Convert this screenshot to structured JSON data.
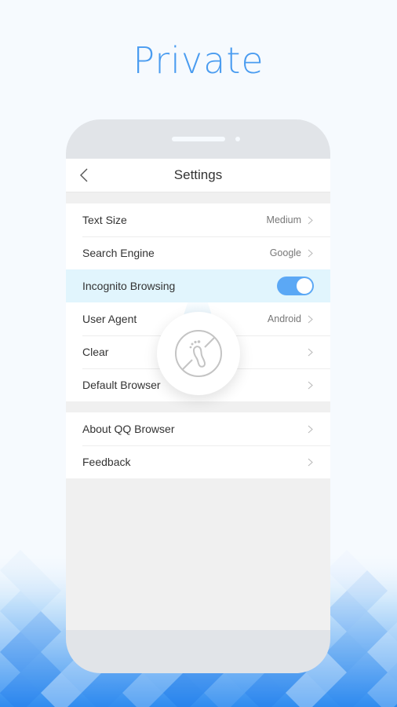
{
  "headline": "Private",
  "settings": {
    "title": "Settings",
    "back_icon": "chevron-left-icon",
    "group1": [
      {
        "label": "Text Size",
        "value": "Medium",
        "type": "chevron"
      },
      {
        "label": "Search Engine",
        "value": "Google",
        "type": "chevron"
      },
      {
        "label": "Incognito Browsing",
        "value": "",
        "type": "toggle",
        "on": true
      },
      {
        "label": "User Agent",
        "value": "Android",
        "type": "chevron"
      },
      {
        "label": "Clear",
        "value": "",
        "type": "chevron"
      },
      {
        "label": "Default Browser",
        "value": "",
        "type": "chevron"
      }
    ],
    "group2": [
      {
        "label": "About QQ Browser",
        "value": "",
        "type": "chevron"
      },
      {
        "label": "Feedback",
        "value": "",
        "type": "chevron"
      }
    ]
  },
  "badge_icon": "no-footprint-icon",
  "colors": {
    "accent": "#4a9cf0",
    "toggle_on": "#5ba8f5",
    "highlight_row": "#e1f5fd"
  }
}
